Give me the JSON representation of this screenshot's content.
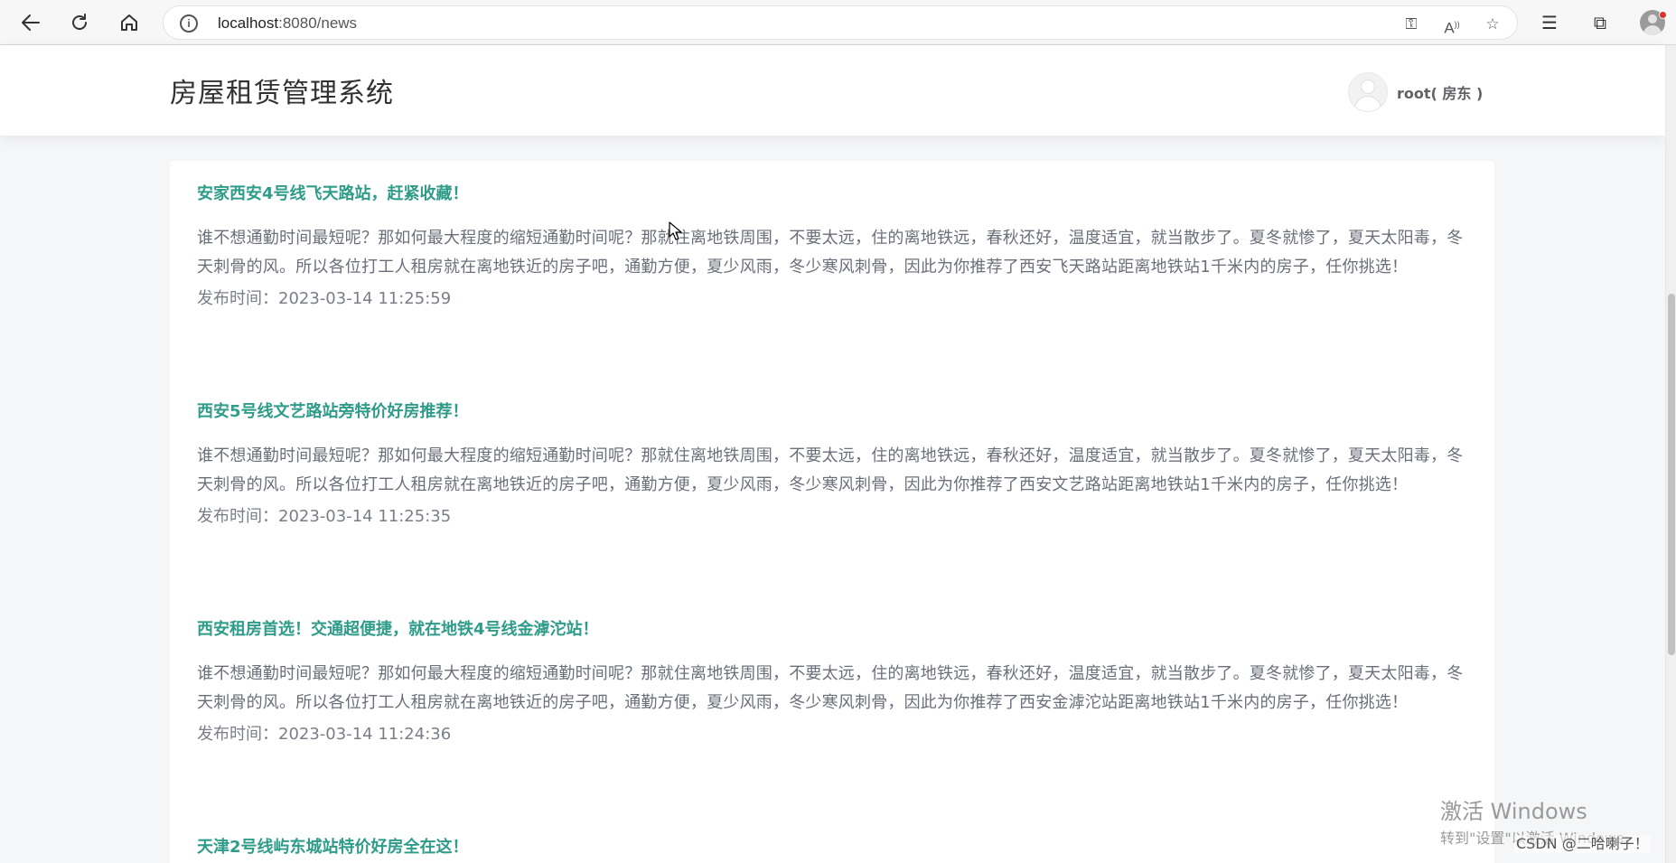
{
  "browser": {
    "url_host": "localhost",
    "url_path": ":8080/news"
  },
  "header": {
    "title": "房屋租赁管理系统",
    "user": "root( 房东 )"
  },
  "news": [
    {
      "title": "安家西安4号线飞天路站，赶紧收藏！",
      "content": "谁不想通勤时间最短呢？那如何最大程度的缩短通勤时间呢？那就住离地铁周围，不要太远，住的离地铁远，春秋还好，温度适宜，就当散步了。夏冬就惨了，夏天太阳毒，冬天刺骨的风。所以各位打工人租房就在离地铁近的房子吧，通勤方便，夏少风雨，冬少寒风刺骨，因此为你推荐了西安飞天路站距离地铁站1千米内的房子，任你挑选！",
      "time": "发布时间：2023-03-14 11:25:59"
    },
    {
      "title": "西安5号线文艺路站旁特价好房推荐！",
      "content": "谁不想通勤时间最短呢？那如何最大程度的缩短通勤时间呢？那就住离地铁周围，不要太远，住的离地铁远，春秋还好，温度适宜，就当散步了。夏冬就惨了，夏天太阳毒，冬天刺骨的风。所以各位打工人租房就在离地铁近的房子吧，通勤方便，夏少风雨，冬少寒风刺骨，因此为你推荐了西安文艺路站距离地铁站1千米内的房子，任你挑选！",
      "time": "发布时间：2023-03-14 11:25:35"
    },
    {
      "title": "西安租房首选！交通超便捷，就在地铁4号线金滹沱站！",
      "content": "谁不想通勤时间最短呢？那如何最大程度的缩短通勤时间呢？那就住离地铁周围，不要太远，住的离地铁远，春秋还好，温度适宜，就当散步了。夏冬就惨了，夏天太阳毒，冬天刺骨的风。所以各位打工人租房就在离地铁近的房子吧，通勤方便，夏少风雨，冬少寒风刺骨，因此为你推荐了西安金滹沱站距离地铁站1千米内的房子，任你挑选！",
      "time": "发布时间：2023-03-14 11:24:36"
    },
    {
      "title": "天津2号线屿东城站特价好房全在这！"
    }
  ],
  "watermark": {
    "line1": "激活 Windows",
    "line2": "转到\"设置\"以激活 Windows。",
    "csdn": "CSDN @二哈喇子！"
  }
}
